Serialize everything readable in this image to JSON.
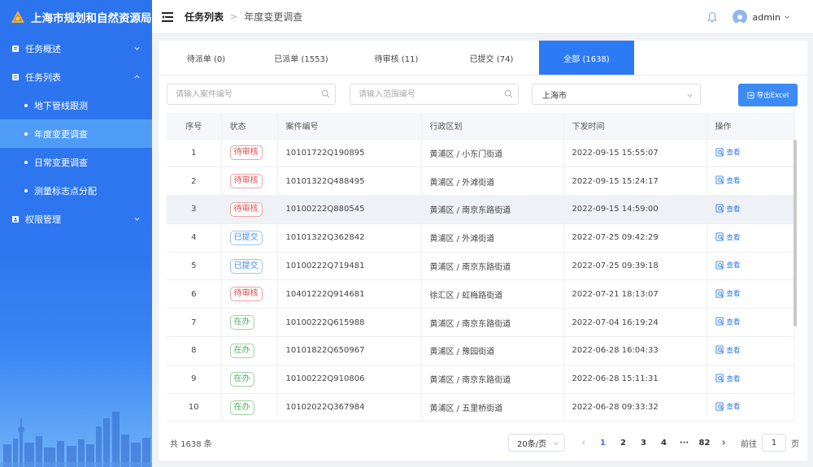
{
  "app": {
    "title": "上海市规划和自然资源局"
  },
  "sidebar": {
    "menu": [
      {
        "label": "任务概述",
        "icon": "book-icon",
        "expanded": false
      },
      {
        "label": "任务列表",
        "icon": "list-icon",
        "expanded": true,
        "children": [
          {
            "label": "地下管线跟测",
            "active": false
          },
          {
            "label": "年度变更调查",
            "active": true
          },
          {
            "label": "日常变更调查",
            "active": false
          },
          {
            "label": "测量标志点分配",
            "active": false
          }
        ]
      },
      {
        "label": "权限管理",
        "icon": "permission-icon",
        "expanded": false
      }
    ]
  },
  "header": {
    "breadcrumb": [
      "任务列表",
      "年度变更调查"
    ],
    "username": "admin"
  },
  "tabs": [
    {
      "label": "待派单 (0)",
      "active": false
    },
    {
      "label": "已派单 (1553)",
      "active": false
    },
    {
      "label": "待审核 (11)",
      "active": false
    },
    {
      "label": "已提交 (74)",
      "active": false
    },
    {
      "label": "全部 (1638)",
      "active": true
    }
  ],
  "filters": {
    "case_placeholder": "请输入案件编号",
    "range_placeholder": "请输入范围编号",
    "region_value": "上海市",
    "export_label": "导出Excel"
  },
  "table": {
    "columns": [
      "序号",
      "状态",
      "案件编号",
      "行政区划",
      "下发时间",
      "操作"
    ],
    "action_label": "查看",
    "rows": [
      {
        "no": "1",
        "status": "待审核",
        "status_color": "red",
        "case": "10101722Q190895",
        "region": "黄浦区 / 小东门街道",
        "time": "2022-09-15 15:55:07"
      },
      {
        "no": "2",
        "status": "待审核",
        "status_color": "red",
        "case": "10101322Q488495",
        "region": "黄浦区 / 外滩街道",
        "time": "2022-09-15 15:24:17"
      },
      {
        "no": "3",
        "status": "待审核",
        "status_color": "red",
        "case": "10100222Q880545",
        "region": "黄浦区 / 南京东路街道",
        "time": "2022-09-15 14:59:00"
      },
      {
        "no": "4",
        "status": "已提交",
        "status_color": "blue",
        "case": "10101322Q362842",
        "region": "黄浦区 / 外滩街道",
        "time": "2022-07-25 09:42:29"
      },
      {
        "no": "5",
        "status": "已提交",
        "status_color": "blue",
        "case": "10100222Q719481",
        "region": "黄浦区 / 南京东路街道",
        "time": "2022-07-25 09:39:18"
      },
      {
        "no": "6",
        "status": "待审核",
        "status_color": "red",
        "case": "10401222Q914681",
        "region": "徐汇区 / 虹梅路街道",
        "time": "2022-07-21 18:13:07"
      },
      {
        "no": "7",
        "status": "在办",
        "status_color": "green",
        "case": "10100222Q615988",
        "region": "黄浦区 / 南京东路街道",
        "time": "2022-07-04 16:19:24"
      },
      {
        "no": "8",
        "status": "在办",
        "status_color": "green",
        "case": "10101822Q650967",
        "region": "黄浦区 / 豫园街道",
        "time": "2022-06-28 16:04:33"
      },
      {
        "no": "9",
        "status": "在办",
        "status_color": "green",
        "case": "10100222Q910806",
        "region": "黄浦区 / 南京东路街道",
        "time": "2022-06-28 15:11:31"
      },
      {
        "no": "10",
        "status": "在办",
        "status_color": "green",
        "case": "10102022Q367984",
        "region": "黄浦区 / 五里桥街道",
        "time": "2022-06-28 09:33:32"
      }
    ]
  },
  "pagination": {
    "total_text": "共 1638 条",
    "page_size": "20条/页",
    "pages": [
      "1",
      "2",
      "3",
      "4",
      "···",
      "82"
    ],
    "current_page": "1",
    "goto_label": "前往",
    "goto_value": "1",
    "goto_suffix": "页"
  },
  "colors": {
    "primary": "#2d7bf4",
    "sidebar": "#2c74ee",
    "red": "#e64a4a",
    "blue": "#3d8cf4",
    "green": "#4cae55"
  }
}
